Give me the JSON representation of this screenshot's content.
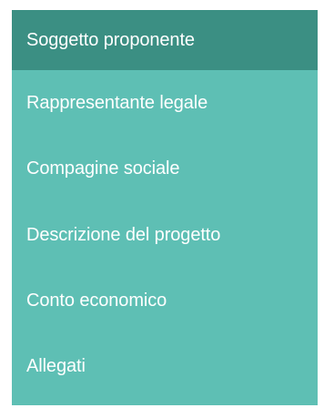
{
  "menu": {
    "items": [
      {
        "label": "Soggetto proponente",
        "active": true
      },
      {
        "label": "Rappresentante legale",
        "active": false
      },
      {
        "label": "Compagine sociale",
        "active": false
      },
      {
        "label": "Descrizione del progetto",
        "active": false
      },
      {
        "label": "Conto economico",
        "active": false
      },
      {
        "label": "Allegati",
        "active": false
      }
    ]
  },
  "colors": {
    "active_background": "#3b8f83",
    "menu_background": "#5ebfb4",
    "text": "#ffffff"
  }
}
